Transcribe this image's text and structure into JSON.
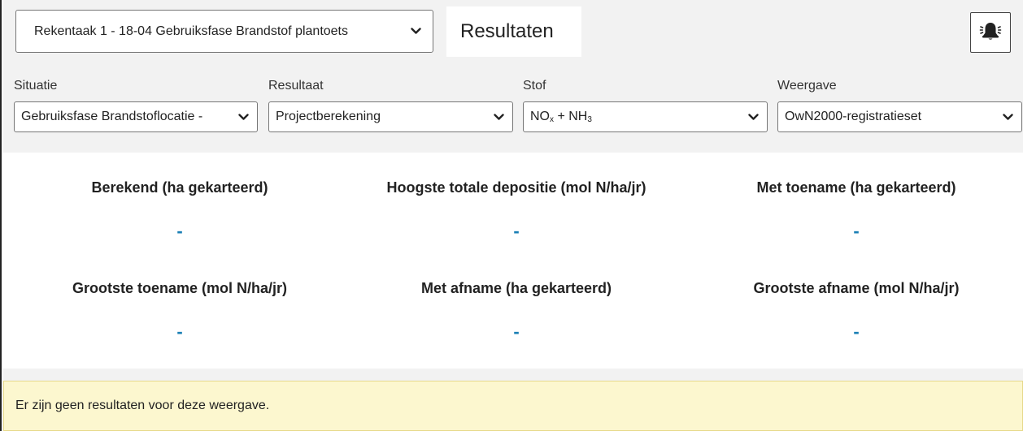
{
  "header": {
    "task_select_value": "Rekentaak 1 - 18-04 Gebruiksfase Brandstof plantoets",
    "active_tab": "Resultaten",
    "notification_icon": "alarm-bell-icon"
  },
  "filters": {
    "situatie": {
      "label": "Situatie",
      "value": "Gebruiksfase Brandstoflocatie -"
    },
    "resultaat": {
      "label": "Resultaat",
      "value": "Projectberekening"
    },
    "stof": {
      "label": "Stof",
      "value_parts": [
        "NO",
        "x",
        " + NH",
        "3"
      ]
    },
    "weergave": {
      "label": "Weergave",
      "value": "OwN2000-registratieset"
    }
  },
  "stats": [
    {
      "title": "Berekend (ha gekarteerd)",
      "value": "-"
    },
    {
      "title": "Hoogste totale depositie (mol N/ha/jr)",
      "value": "-"
    },
    {
      "title": "Met toename (ha gekarteerd)",
      "value": "-"
    },
    {
      "title": "Grootste toename (mol N/ha/jr)",
      "value": "-"
    },
    {
      "title": "Met afname (ha gekarteerd)",
      "value": "-"
    },
    {
      "title": "Grootste afname (mol N/ha/jr)",
      "value": "-"
    }
  ],
  "notice": {
    "text": "Er zijn geen resultaten voor deze weergave."
  },
  "colors": {
    "value_accent": "#1a7fb5",
    "notice_bg": "#fcf7cf",
    "panel_bg": "#f2f2f2"
  }
}
